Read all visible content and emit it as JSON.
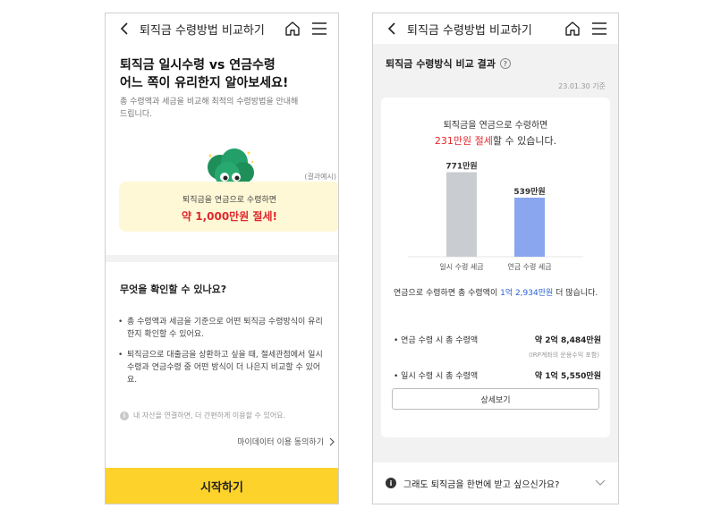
{
  "left": {
    "header": {
      "title": "퇴직금 수령방법 비교하기"
    },
    "hero": {
      "title_line1": "퇴직금 일시수령 vs 연금수령",
      "title_line2": "어느 쪽이 유리한지 알아보세요!",
      "desc_line1": "총 수령액과 세금을 비교해 최적의 수령방법을 안내해",
      "desc_line2": "드립니다."
    },
    "example": {
      "tag": "(결과예시)",
      "line1": "퇴직금을 연금으로 수령하면",
      "line2": "약 1,000만원 절세!"
    },
    "section": {
      "title": "무엇을 확인할 수 있나요?",
      "bullets": [
        "총 수령액과 세금을 기준으로 어떤 퇴직금 수령방식이 유리한지 확인할 수 있어요.",
        "퇴직금으로 대출금을 상환하고 싶을 때, 절세관점에서 일시수령과 연금수령 중 어떤 방식이 더 나은지 비교할 수 있어요."
      ],
      "bullet_mark": "•",
      "info_icon": "i",
      "note": "내 자산을 연결하면, 더 간편하게 이용할 수 있어요.",
      "consent_link": "마이데이터 이용 동의하기"
    },
    "cta": {
      "label": "시작하기"
    }
  },
  "right": {
    "header": {
      "title": "퇴직금 수령방법 비교하기"
    },
    "result": {
      "title": "퇴직금 수령방식 비교 결과",
      "help_icon": "?",
      "date": "23.01.30 기준"
    },
    "card": {
      "line1": "퇴직금을 연금으로 수령하면",
      "line2_red": "231만원 절세",
      "line2_rest": "할 수 있습니다.",
      "summary_pre": "연금으로 수령하면 총 수령액이 ",
      "summary_blue": "1억 2,934만원",
      "summary_post": " 더 많습니다.",
      "rows": [
        {
          "label": "• 연금 수령 시 총 수령액",
          "value": "약 2억 8,484만원"
        },
        {
          "label": "• 일시 수령 시 총 수령액",
          "value": "약 1억 5,550만원"
        }
      ],
      "note": "(IRP계좌의 운용수익 포함)",
      "button": "상세보기"
    },
    "faq": {
      "label": "그래도 퇴직금을 한번에 받고 싶으신가요?",
      "info_icon": "i"
    }
  },
  "chart_data": {
    "type": "bar",
    "categories": [
      "일시 수령 세금",
      "연금 수령 세금"
    ],
    "values": [
      771,
      539
    ],
    "value_labels": [
      "771만원",
      "539만원"
    ],
    "unit": "만원",
    "ylim": [
      0,
      800
    ],
    "colors": [
      "#c9cdd2",
      "#8aa6ef"
    ],
    "grid": false
  },
  "colors": {
    "accent_yellow": "#fcd22b",
    "highlight_red": "#e0282e",
    "highlight_blue": "#2a63d8"
  }
}
